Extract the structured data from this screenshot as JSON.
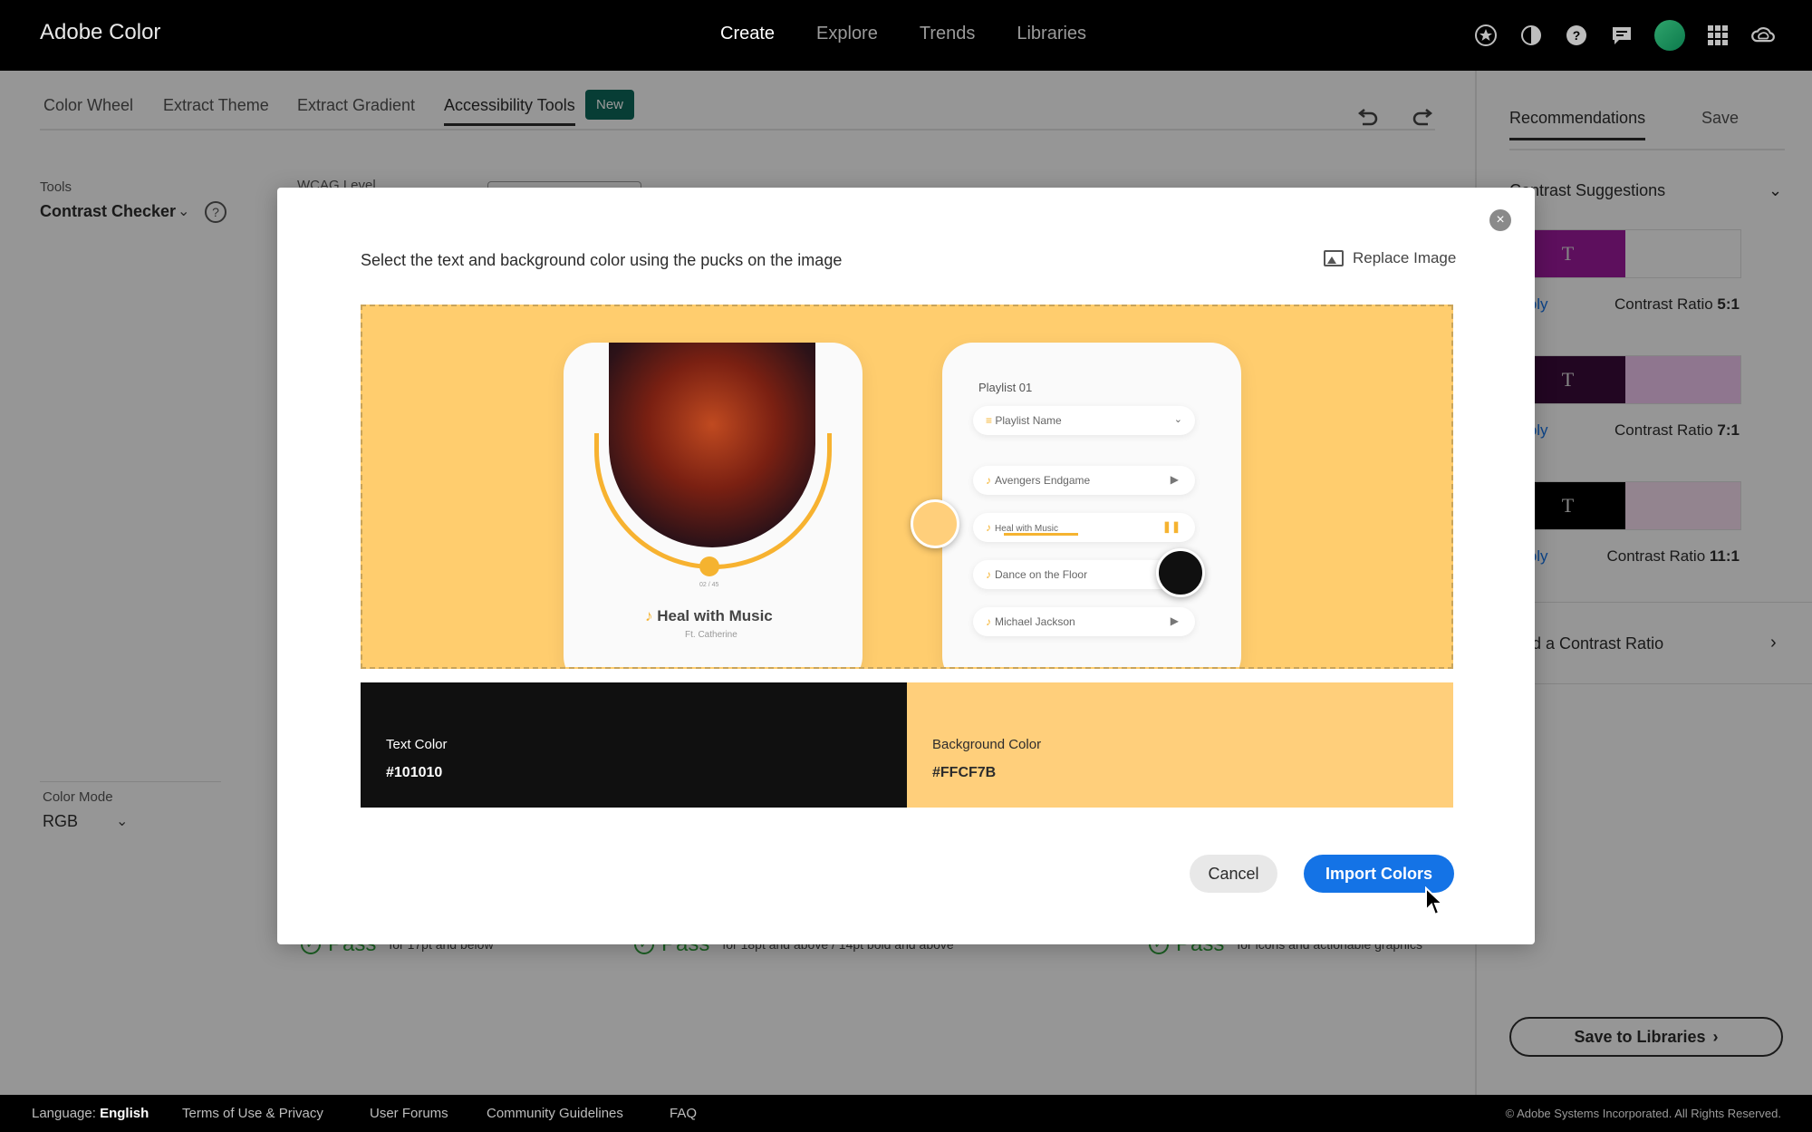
{
  "app": {
    "title": "Adobe Color",
    "nav": [
      "Create",
      "Explore",
      "Trends",
      "Libraries"
    ],
    "active_nav": "Create"
  },
  "header_icons": [
    "star-badge-icon",
    "contrast-icon",
    "help-icon",
    "chat-icon",
    "avatar",
    "apps-grid-icon",
    "creative-cloud-icon"
  ],
  "tabs": {
    "items": [
      "Color Wheel",
      "Extract Theme",
      "Extract Gradient",
      "Accessibility Tools"
    ],
    "active": "Accessibility Tools",
    "new_badge": "New"
  },
  "tools": {
    "label": "Tools",
    "selected": "Contrast Checker",
    "wcag_label": "WCAG Level"
  },
  "color_mode": {
    "label": "Color Mode",
    "value": "RGB"
  },
  "pass_results": [
    {
      "word": "Pass",
      "desc": "for 17pt and below"
    },
    {
      "word": "Pass",
      "desc": "for 18pt and above / 14pt bold and above"
    },
    {
      "word": "Pass",
      "desc": "for icons and actionable graphics"
    }
  ],
  "right_panel": {
    "tabs": [
      "Recommendations",
      "Save"
    ],
    "active_tab": "Recommendations",
    "suggestions_title": "Contrast Suggestions",
    "suggestions": [
      {
        "apply": "Apply",
        "ratio_label": "Contrast Ratio",
        "ratio_value": "5:1",
        "text_color": "#9b1a9b",
        "bg_color": "#fafafa"
      },
      {
        "apply": "Apply",
        "ratio_label": "Contrast Ratio",
        "ratio_value": "7:1",
        "text_color": "#3a0b3a",
        "bg_color": "#eec5ee"
      },
      {
        "apply": "Apply",
        "ratio_label": "Contrast Ratio",
        "ratio_value": "11:1",
        "text_color": "#000000",
        "bg_color": "#f5dcef"
      }
    ],
    "find_ratio": "Find a Contrast Ratio",
    "save_libraries": "Save to Libraries"
  },
  "modal": {
    "instruction": "Select the text and background color using the pucks on the image",
    "replace_image": "Replace Image",
    "image": {
      "card1_title": "Heal with Music",
      "card1_subtitle": "Ft. Catherine",
      "card1_time": "02 / 45",
      "playlist_title": "Playlist 01",
      "playlist_select": "Playlist Name",
      "tracks": [
        "Avengers Endgame",
        "Heal with Music",
        "Dance on the Floor",
        "Michael Jackson"
      ]
    },
    "text_color": {
      "label": "Text Color",
      "value": "#101010"
    },
    "background_color": {
      "label": "Background Color",
      "value": "#FFCF7B"
    },
    "cancel": "Cancel",
    "import": "Import Colors"
  },
  "footer": {
    "language_label": "Language:",
    "language_value": "English",
    "links": [
      "Terms of Use & Privacy",
      "User Forums",
      "Community Guidelines",
      "FAQ"
    ],
    "copyright": "© Adobe Systems Incorporated. All Rights Reserved."
  },
  "colors": {
    "accent": "#1473e6",
    "badge": "#0d6659",
    "pass": "#2d9d3a",
    "puck_background": "#FFCF7B",
    "puck_text": "#101010"
  }
}
